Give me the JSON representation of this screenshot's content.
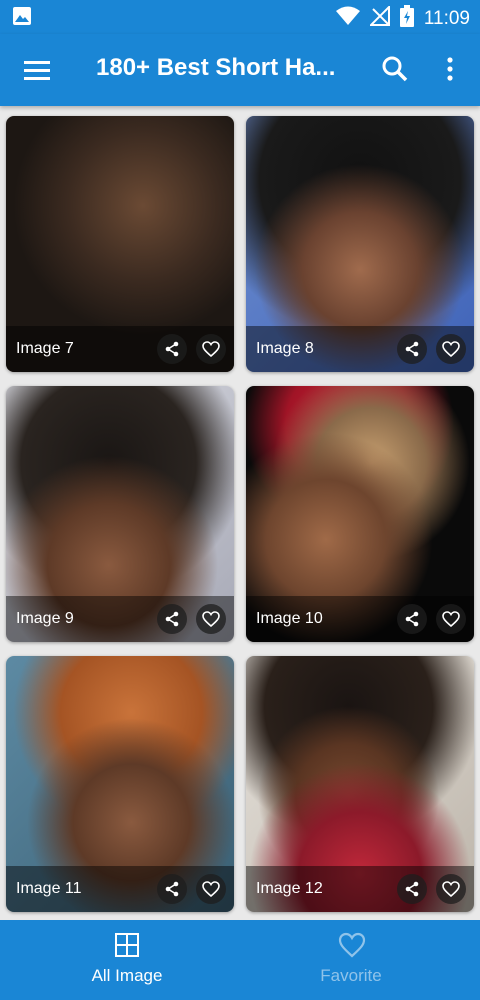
{
  "status_bar": {
    "time": "11:09",
    "icons": [
      "image-icon",
      "wifi-icon",
      "no-signal-icon",
      "battery-charging-icon"
    ]
  },
  "app_bar": {
    "title": "180+ Best Short Ha...",
    "icons": [
      "menu-icon",
      "search-icon",
      "more-vert-icon"
    ]
  },
  "colors": {
    "primary": "#1a86d5",
    "inactive_nav": "#8fc3ea",
    "overlay": "rgba(0,0,0,0.45)"
  },
  "cards": [
    {
      "label": "Image 7"
    },
    {
      "label": "Image 8"
    },
    {
      "label": "Image 9"
    },
    {
      "label": "Image 10"
    },
    {
      "label": "Image 11"
    },
    {
      "label": "Image 12"
    }
  ],
  "bottom_nav": {
    "items": [
      {
        "label": "All Image",
        "icon": "grid-icon",
        "active": true
      },
      {
        "label": "Favorite",
        "icon": "heart-icon",
        "active": false
      }
    ]
  }
}
